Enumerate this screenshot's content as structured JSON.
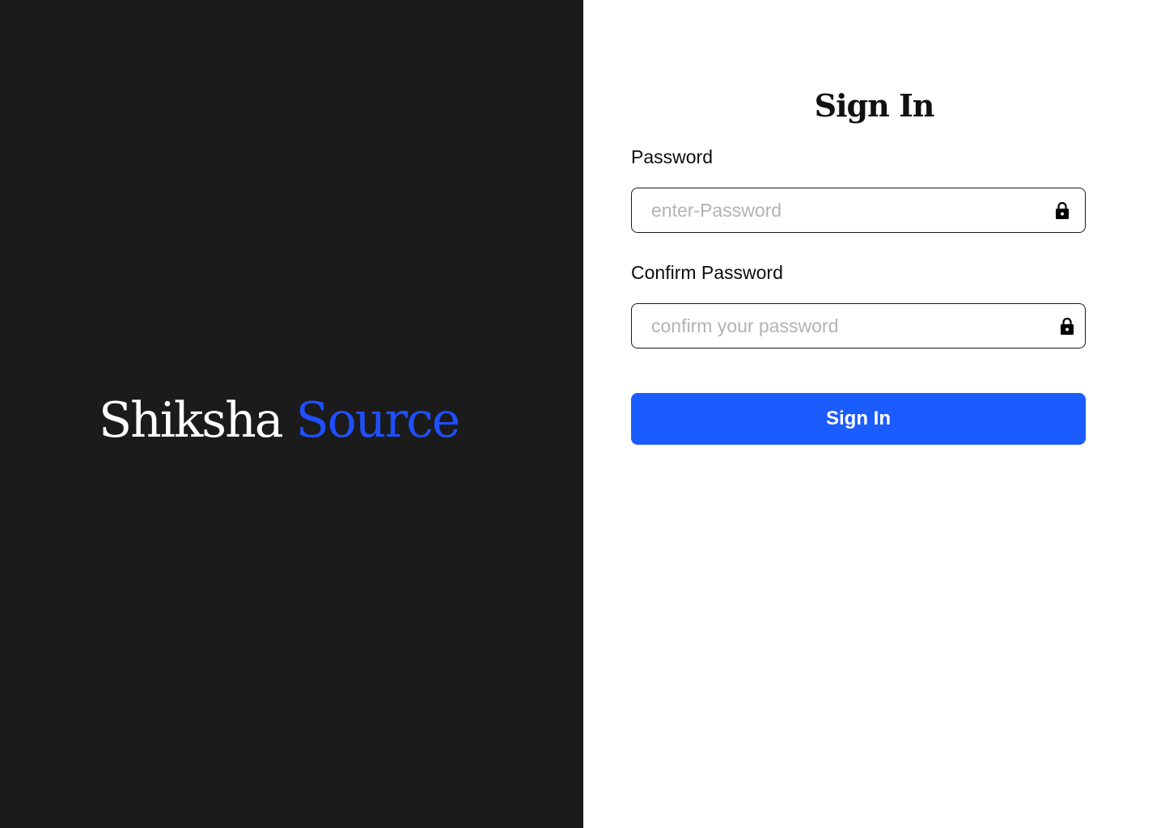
{
  "brand": {
    "word_1": "Shiksha",
    "word_2": "Source",
    "colors": {
      "background": "#1b1b1b",
      "word_1": "#ffffff",
      "word_2": "#1f4fff"
    }
  },
  "form": {
    "title": "Sign In",
    "password": {
      "label": "Password",
      "placeholder": "enter-Password",
      "value": "",
      "icon": "lock-icon"
    },
    "confirm_password": {
      "label": "Confirm Password",
      "placeholder": "confirm your password",
      "value": "",
      "icon": "lock-icon"
    },
    "submit_label": "Sign In",
    "colors": {
      "accent": "#1b5cff",
      "input_border": "#1a1a1a",
      "placeholder": "#b3b3b3"
    }
  }
}
